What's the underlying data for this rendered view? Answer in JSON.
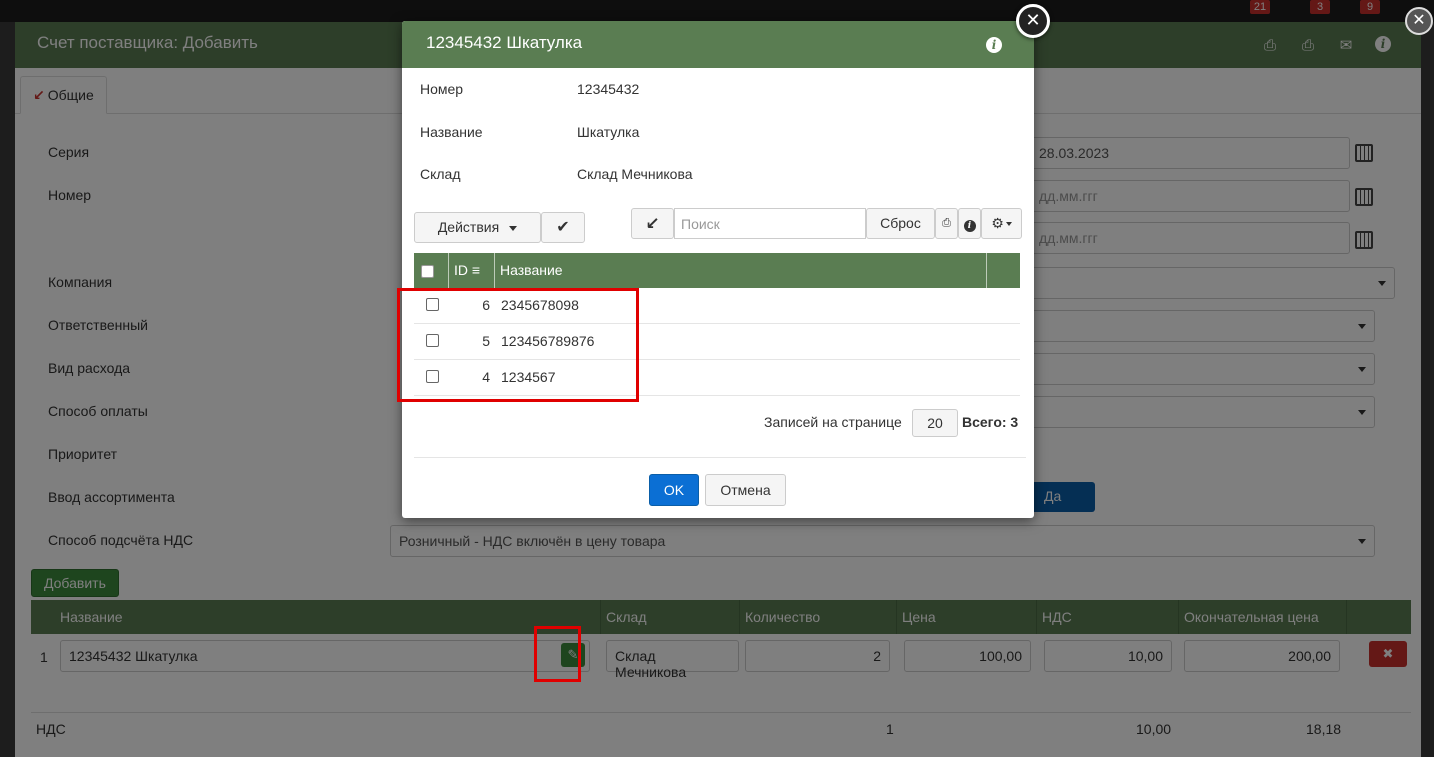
{
  "topbar": {
    "badges": [
      "21",
      "3",
      "9"
    ]
  },
  "bg": {
    "title": "Счет поставщика: Добавить",
    "tab_general": "Общие",
    "fields": {
      "series": "Серия",
      "number": "Номер",
      "company": "Компания",
      "responsible": "Ответственный",
      "expense_type": "Вид расхода",
      "payment_method": "Способ оплаты",
      "priority": "Приоритет",
      "assortment_input": "Ввод ассортимента",
      "vat_method": "Способ подсчёта НДС"
    },
    "date_value": "28.03.2023",
    "date_placeholder": "дд.мм.ггг",
    "vat_method_value": "Розничный - НДС включён в цену товара",
    "assortment_toggle": "Да",
    "add_button": "Добавить",
    "grid": {
      "headers": [
        "Название",
        "Склад",
        "Количество",
        "Цена",
        "НДС",
        "Окончательная цена"
      ],
      "row": {
        "index": "1",
        "name": "12345432 Шкатулка",
        "warehouse": "Склад Мечникова",
        "qty": "2",
        "price": "100,00",
        "vat": "10,00",
        "final": "200,00"
      }
    },
    "totals": {
      "label": "НДС",
      "qty": "1",
      "vat": "10,00",
      "final": "18,18"
    }
  },
  "modal": {
    "title": "12345432 Шкатулка",
    "details": [
      {
        "label": "Номер",
        "value": "12345432"
      },
      {
        "label": "Название",
        "value": "Шкатулка"
      },
      {
        "label": "Склад",
        "value": "Склад Мечникова"
      }
    ],
    "actions_label": "Действия",
    "search_placeholder": "Поиск",
    "reset_label": "Сброс",
    "table": {
      "col_id": "ID",
      "col_name": "Название",
      "rows": [
        {
          "id": "6",
          "name": "2345678098"
        },
        {
          "id": "5",
          "name": "123456789876"
        },
        {
          "id": "4",
          "name": "1234567"
        }
      ]
    },
    "pager": {
      "label": "Записей на странице",
      "per_page": "20",
      "total": "Всего: 3"
    },
    "ok_label": "OK",
    "cancel_label": "Отмена"
  },
  "colors": {
    "header_green": "#5a7d52",
    "primary_blue": "#0b6fd4",
    "highlight_red": "#e00000"
  }
}
